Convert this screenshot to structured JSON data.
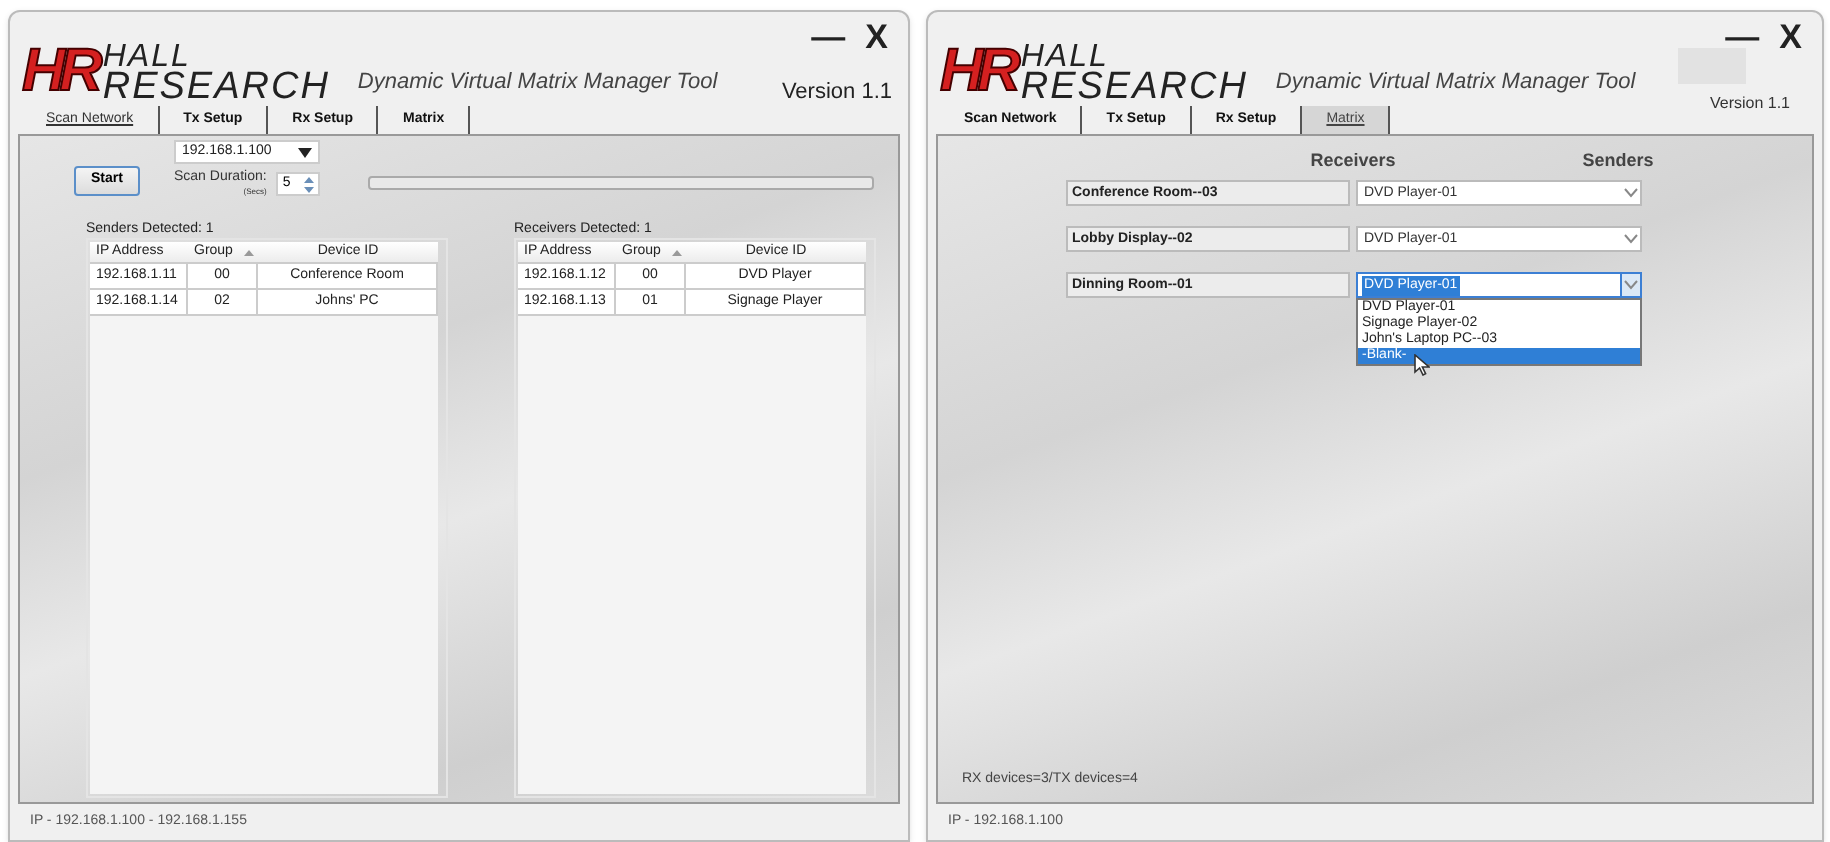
{
  "windows": [
    {
      "kind": "scan",
      "logo": {
        "mark": "HR",
        "line1": "HALL",
        "line2": "RESEARCH"
      },
      "app_title": "Dynamic Virtual Matrix Manager Tool",
      "version": "Version 1.1",
      "controls": [
        "—",
        "X"
      ],
      "tabs": [
        {
          "label": "Scan Network",
          "selected": true
        },
        {
          "label": "Tx Setup",
          "selected": false
        },
        {
          "label": "Rx Setup",
          "selected": false
        },
        {
          "label": "Matrix",
          "selected": false
        }
      ],
      "ip_select": "192.168.1.100",
      "start_button": "Start",
      "scan_duration": {
        "label": "Scan Duration:",
        "unit": "(Secs)",
        "value": "5"
      },
      "progress": {
        "level": 0
      },
      "tables": [
        {
          "title": "Senders Detected: 1",
          "columns": [
            "IP Address",
            "Group",
            "Device ID"
          ],
          "rows": [
            [
              "192.168.1.11",
              "00",
              "Conference Room"
            ],
            [
              "192.168.1.14",
              "02",
              "Johns' PC"
            ]
          ]
        },
        {
          "title": "Receivers Detected: 1",
          "columns": [
            "IP Address",
            "Group",
            "Device ID"
          ],
          "rows": [
            [
              "192.168.1.12",
              "00",
              "DVD Player"
            ],
            [
              "192.168.1.13",
              "01",
              "Signage Player"
            ]
          ]
        }
      ],
      "status_bar": "IP - 192.168.1.100 - 192.168.1.155"
    },
    {
      "kind": "matrix",
      "logo": {
        "mark": "HR",
        "line1": "HALL",
        "line2": "RESEARCH"
      },
      "app_title": "Dynamic Virtual Matrix Manager Tool",
      "version": "Version 1.1",
      "controls": [
        "—",
        "X"
      ],
      "tabs": [
        {
          "label": "Scan Network",
          "selected": false
        },
        {
          "label": "Tx Setup",
          "selected": false
        },
        {
          "label": "Rx Setup",
          "selected": false
        },
        {
          "label": "Matrix",
          "selected": true
        }
      ],
      "headers": [
        "Receivers",
        "Senders"
      ],
      "rows": [
        {
          "receiver": "Conference Room--03",
          "sender": "DVD Player-01",
          "open": false
        },
        {
          "receiver": "Lobby Display--02",
          "sender": "DVD Player-01",
          "open": false
        },
        {
          "receiver": "Dinning Room--01",
          "sender": "DVD Player-01",
          "open": true,
          "options": [
            {
              "label": "DVD Player-01",
              "selected": false
            },
            {
              "label": "Signage Player-02",
              "selected": false
            },
            {
              "label": "John's Laptop PC--03",
              "selected": false
            },
            {
              "label": "-Blank-",
              "selected": true
            }
          ]
        }
      ],
      "footer": "RX devices=3/TX devices=4",
      "status_bar": "IP - 192.168.1.100"
    }
  ]
}
